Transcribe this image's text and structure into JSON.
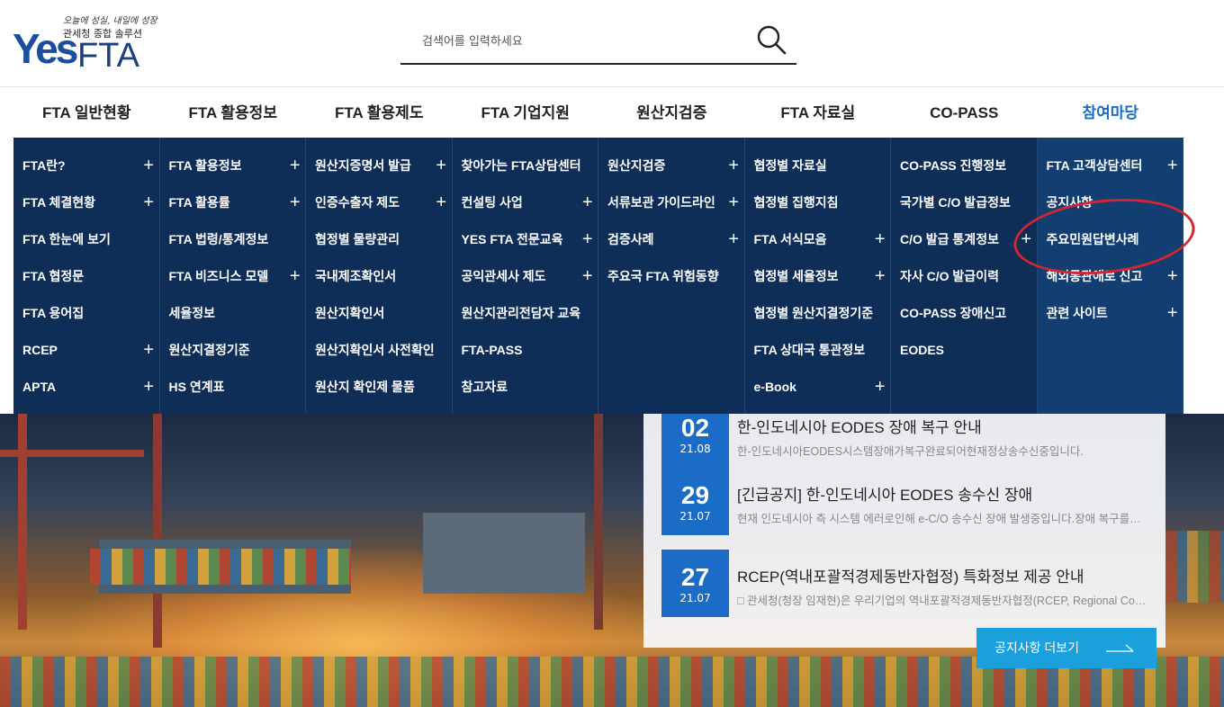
{
  "logo": {
    "slogan": "오늘에 성실, 내일에 성장",
    "subtitle": "관세청 종합 솔루션",
    "name_yes": "Yes",
    "name_fta": "FTA"
  },
  "search": {
    "placeholder": "검색어를 입력하세요"
  },
  "gnb": [
    "FTA 일반현황",
    "FTA 활용정보",
    "FTA 활용제도",
    "FTA 기업지원",
    "원산지검증",
    "FTA 자료실",
    "CO-PASS",
    "참여마당"
  ],
  "gnb_active_index": 7,
  "mega_menu": [
    [
      {
        "label": "FTA란?",
        "plus": "+"
      },
      {
        "label": "FTA 체결현황",
        "plus": "+"
      },
      {
        "label": "FTA 한눈에 보기",
        "plus": ""
      },
      {
        "label": "FTA 협정문",
        "plus": ""
      },
      {
        "label": "FTA 용어집",
        "plus": ""
      },
      {
        "label": "RCEP",
        "plus": "+"
      },
      {
        "label": "APTA",
        "plus": "+"
      }
    ],
    [
      {
        "label": "FTA 활용정보",
        "plus": "+"
      },
      {
        "label": "FTA 활용률",
        "plus": "+"
      },
      {
        "label": "FTA 법령/통계정보",
        "plus": ""
      },
      {
        "label": "FTA 비즈니스 모델",
        "plus": "+"
      },
      {
        "label": "세율정보",
        "plus": ""
      },
      {
        "label": "원산지결정기준",
        "plus": ""
      },
      {
        "label": "HS 연계표",
        "plus": ""
      }
    ],
    [
      {
        "label": "원산지증명서 발급",
        "plus": "+"
      },
      {
        "label": "인증수출자 제도",
        "plus": "+"
      },
      {
        "label": "협정별 물량관리",
        "plus": ""
      },
      {
        "label": "국내제조확인서",
        "plus": ""
      },
      {
        "label": "원산지확인서",
        "plus": ""
      },
      {
        "label": "원산지확인서 사전확인",
        "plus": ""
      },
      {
        "label": "원산지 확인제 물품",
        "plus": ""
      }
    ],
    [
      {
        "label": "찾아가는 FTA상담센터",
        "plus": ""
      },
      {
        "label": "컨설팅 사업",
        "plus": "+"
      },
      {
        "label": "YES FTA 전문교육",
        "plus": "+"
      },
      {
        "label": "공익관세사 제도",
        "plus": "+"
      },
      {
        "label": "원산지관리전담자 교육",
        "plus": ""
      },
      {
        "label": "FTA-PASS",
        "plus": ""
      },
      {
        "label": "참고자료",
        "plus": ""
      }
    ],
    [
      {
        "label": "원산지검증",
        "plus": "+"
      },
      {
        "label": "서류보관 가이드라인",
        "plus": "+"
      },
      {
        "label": "검증사례",
        "plus": "+"
      },
      {
        "label": "주요국 FTA 위험동향",
        "plus": ""
      }
    ],
    [
      {
        "label": "협정별 자료실",
        "plus": ""
      },
      {
        "label": "협정별 집행지침",
        "plus": ""
      },
      {
        "label": "FTA 서식모음",
        "plus": "+"
      },
      {
        "label": "협정별 세율정보",
        "plus": "+"
      },
      {
        "label": "협정별 원산지결정기준",
        "plus": ""
      },
      {
        "label": "FTA 상대국 통관정보",
        "plus": ""
      },
      {
        "label": "e-Book",
        "plus": "+"
      }
    ],
    [
      {
        "label": "CO-PASS 진행정보",
        "plus": ""
      },
      {
        "label": "국가별 C/O 발급정보",
        "plus": ""
      },
      {
        "label": "C/O 발급 통계정보",
        "plus": "+"
      },
      {
        "label": "자사 C/O 발급이력",
        "plus": ""
      },
      {
        "label": "CO-PASS 장애신고",
        "plus": ""
      },
      {
        "label": "EODES",
        "plus": ""
      }
    ],
    [
      {
        "label": "FTA 고객상담센터",
        "plus": "+"
      },
      {
        "label": "공지사항",
        "plus": ""
      },
      {
        "label": "주요민원답변사례",
        "plus": ""
      },
      {
        "label": "해외통관애로 신고",
        "plus": "+"
      },
      {
        "label": "관련 사이트",
        "plus": "+"
      }
    ]
  ],
  "notices": [
    {
      "day": "02",
      "month": "21.08",
      "title": "한-인도네시아 EODES 장애 복구 안내",
      "desc": "한-인도네시아EODES시스템장애가복구완료되어현재정상송수신중입니다."
    },
    {
      "day": "29",
      "month": "21.07",
      "title": "[긴급공지] 한-인도네시아 EODES 송수신 장애",
      "desc": "현재 인도네시아 측 시스템 에러로인해 e-C/O 송수신 장애 발생중입니다.장애 복구를위해 노력하고 있습니다."
    },
    {
      "day": "27",
      "month": "21.07",
      "title": "RCEP(역내포괄적경제동반자협정) 특화정보 제공 안내",
      "desc": "□ 관세청(청장 임재현)은 우리기업의 역내포괄적경제동반자협정(RCEP, Regional Comprehensive Economic Partnership)"
    }
  ],
  "more_button": "공지사항 더보기",
  "colors": {
    "brand_blue": "#1a6cc7",
    "menu_bg": "#0e2d57",
    "highlight_red": "#d3262f",
    "more_button": "#1aa0dc"
  }
}
